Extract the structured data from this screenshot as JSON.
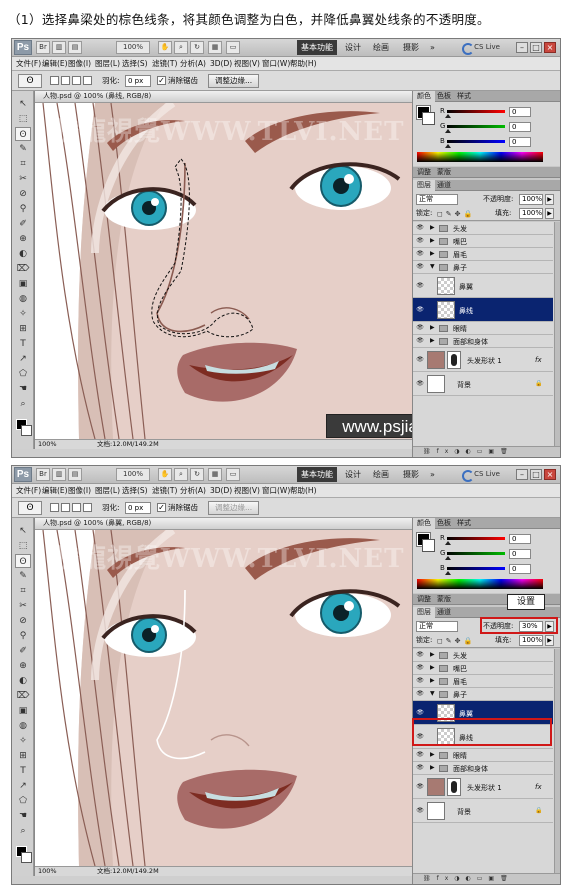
{
  "caption": "（1）选择鼻梁处的棕色线条，将其颜色调整为白色，并降低鼻翼处线条的不透明度。",
  "colors": {
    "accent": "#0a2470",
    "highlight": "#d01818",
    "skin": "#e6cfc8",
    "lips": "#a86b68",
    "brow": "#9a5a4c"
  },
  "screens": [
    {
      "app": {
        "logo": "Ps",
        "zoom": "100%",
        "workspaces": [
          "基本功能",
          "设计",
          "绘画",
          "摄影"
        ],
        "cslive": "CS Live"
      },
      "menus": [
        "文件(F)",
        "编辑(E)",
        "图像(I)",
        "图层(L)",
        "选择(S)",
        "滤镜(T)",
        "分析(A)",
        "3D(D)",
        "视图(V)",
        "窗口(W)",
        "帮助(H)"
      ],
      "options": {
        "feather_label": "羽化:",
        "feather_value": "0 px",
        "antialias_label": "消除锯齿",
        "refine_button": "调整边缘...",
        "refine_enabled": true
      },
      "document": {
        "tab_title": "人物.psd @ 100% (鼻线, RGB/8)",
        "zoom": "100%",
        "doc_size": "文档:12.0M/149.2M",
        "watermark": "騰龍視覺WWW.TLVI.NET",
        "site_badge": "www.psjia.com",
        "nose_line_color": "#8a5a50",
        "selection_shown": true
      },
      "color_panel": {
        "tabs": [
          "颜色",
          "色板",
          "样式"
        ],
        "values": [
          "0",
          "0",
          "0"
        ]
      },
      "adjust_tabs": [
        "调整",
        "蒙版"
      ],
      "layers_panel": {
        "tabs": [
          "图层",
          "通道"
        ],
        "blend_mode": "正常",
        "opacity_label": "不透明度:",
        "opacity": "100%",
        "lock_label": "锁定:",
        "fill_label": "填充:",
        "fill": "100%",
        "layers": [
          {
            "name": "头发",
            "kind": "group",
            "selected": false
          },
          {
            "name": "嘴巴",
            "kind": "group",
            "selected": false
          },
          {
            "name": "眉毛",
            "kind": "group",
            "selected": false
          },
          {
            "name": "鼻子",
            "kind": "group-open",
            "selected": false
          },
          {
            "name": "鼻翼",
            "kind": "layer",
            "selected": false
          },
          {
            "name": "鼻线",
            "kind": "layer",
            "selected": true
          },
          {
            "name": "眼睛",
            "kind": "group",
            "selected": false
          },
          {
            "name": "面部和身体",
            "kind": "group",
            "selected": false
          },
          {
            "name": "头发形状 1",
            "kind": "shape",
            "selected": false
          },
          {
            "name": "背景",
            "kind": "background",
            "selected": false
          }
        ]
      }
    },
    {
      "app": {
        "logo": "Ps",
        "zoom": "100%",
        "workspaces": [
          "基本功能",
          "设计",
          "绘画",
          "摄影"
        ],
        "cslive": "CS Live"
      },
      "menus": [
        "文件(F)",
        "编辑(E)",
        "图像(I)",
        "图层(L)",
        "选择(S)",
        "滤镜(T)",
        "分析(A)",
        "3D(D)",
        "视图(V)",
        "窗口(W)",
        "帮助(H)"
      ],
      "options": {
        "feather_label": "羽化:",
        "feather_value": "0 px",
        "antialias_label": "消除锯齿",
        "refine_button": "调整边缘...",
        "refine_enabled": false
      },
      "document": {
        "tab_title": "人物.psd @ 100% (鼻翼, RGB/8)",
        "zoom": "100%",
        "doc_size": "文档:12.0M/149.2M",
        "watermark": "騰龍視覺WWW.TLVI.NET",
        "site_badge": "",
        "nose_line_color": "#ffffff",
        "selection_shown": false
      },
      "color_panel": {
        "tabs": [
          "颜色",
          "色板",
          "样式"
        ],
        "values": [
          "0",
          "0",
          "0"
        ]
      },
      "adjust_tabs": [
        "调整",
        "蒙版"
      ],
      "callout": "设置",
      "layers_panel": {
        "tabs": [
          "图层",
          "通道"
        ],
        "blend_mode": "正常",
        "opacity_label": "不透明度:",
        "opacity": "30%",
        "lock_label": "锁定:",
        "fill_label": "填充:",
        "fill": "100%",
        "layers": [
          {
            "name": "头发",
            "kind": "group",
            "selected": false
          },
          {
            "name": "嘴巴",
            "kind": "group",
            "selected": false
          },
          {
            "name": "眉毛",
            "kind": "group",
            "selected": false
          },
          {
            "name": "鼻子",
            "kind": "group-open",
            "selected": false
          },
          {
            "name": "鼻翼",
            "kind": "layer",
            "selected": true
          },
          {
            "name": "鼻线",
            "kind": "layer",
            "selected": false
          },
          {
            "name": "眼睛",
            "kind": "group",
            "selected": false
          },
          {
            "name": "面部和身体",
            "kind": "group",
            "selected": false
          },
          {
            "name": "头发形状 1",
            "kind": "shape",
            "selected": false
          },
          {
            "name": "背景",
            "kind": "background",
            "selected": false
          }
        ]
      }
    }
  ]
}
